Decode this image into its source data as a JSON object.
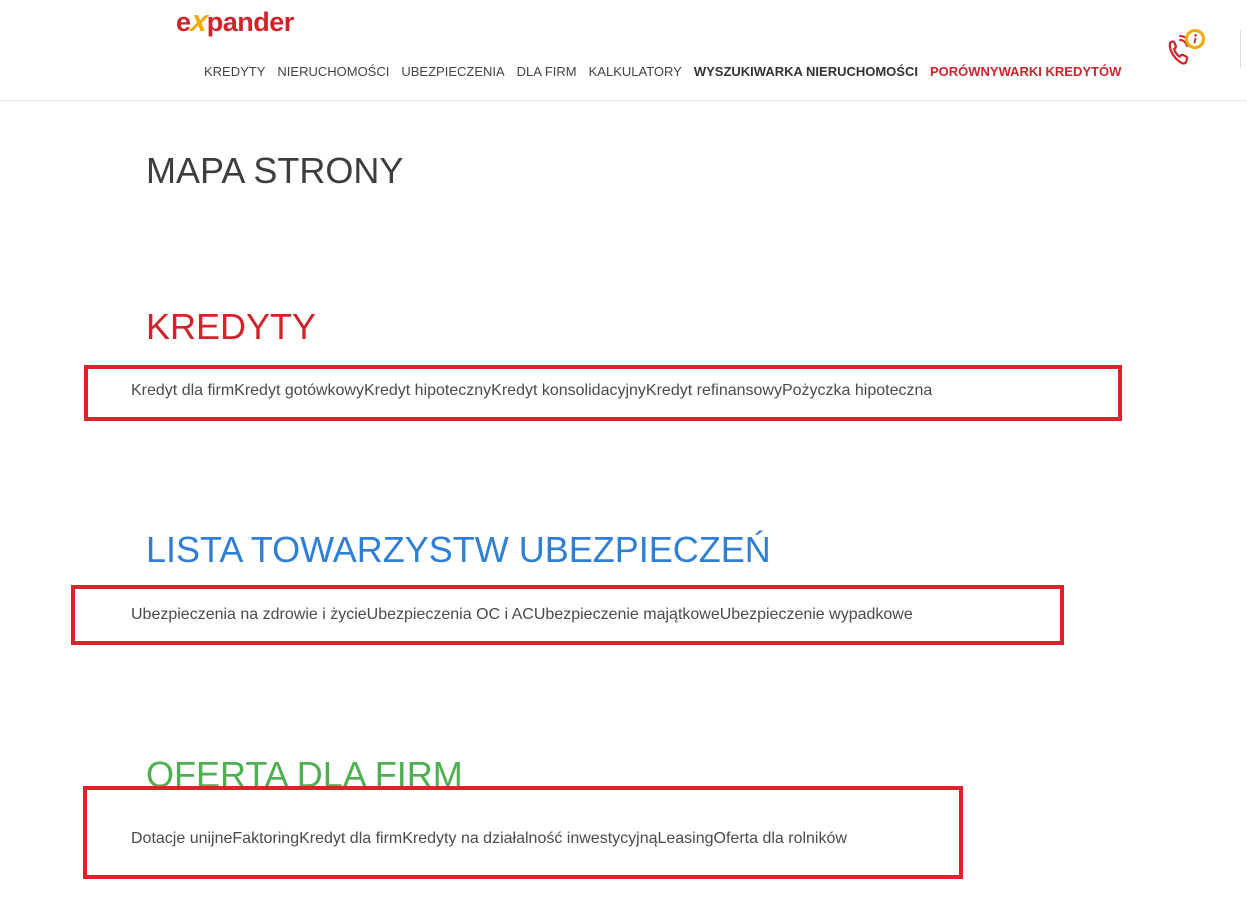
{
  "header": {
    "logo": {
      "prefix": "e",
      "x": "x",
      "rest": "pander"
    },
    "nav": [
      {
        "label": "KREDYTY"
      },
      {
        "label": "NIERUCHOMOŚCI"
      },
      {
        "label": "UBEZPIECZENIA"
      },
      {
        "label": "DLA FIRM"
      },
      {
        "label": "KALKULATORY"
      },
      {
        "label": "WYSZUKIWARKA NIERUCHOMOŚCI"
      },
      {
        "label": "PORÓWNYWARKI KREDYTÓW"
      }
    ],
    "phone_icon": "phone-info-icon"
  },
  "page": {
    "title": "MAPA STRONY"
  },
  "sections": [
    {
      "title": "KREDYTY",
      "color": "#d2232a",
      "links": [
        "Kredyt dla firm",
        "Kredyt gotówkowy",
        "Kredyt hipoteczny",
        "Kredyt konsolidacyjny",
        "Kredyt refinansowy",
        "Pożyczka hipoteczna"
      ]
    },
    {
      "title": "LISTA TOWARZYSTW UBEZPIECZEŃ",
      "color": "#2f7fd6",
      "links": [
        "Ubezpieczenia na zdrowie i życie",
        "Ubezpieczenia OC i AC",
        "Ubezpieczenie majątkowe",
        "Ubezpieczenie wypadkowe"
      ]
    },
    {
      "title": "OFERTA DLA FIRM",
      "color": "#4caf50",
      "links": [
        "Dotacje unijne",
        "Faktoring",
        "Kredyt dla firm",
        "Kredyty na działalność inwestycyjną",
        "Leasing",
        "Oferta dla rolników"
      ]
    }
  ],
  "colors": {
    "brand_red": "#d2232a",
    "brand_yellow": "#f2a900",
    "highlight_box": "#e0202a"
  }
}
